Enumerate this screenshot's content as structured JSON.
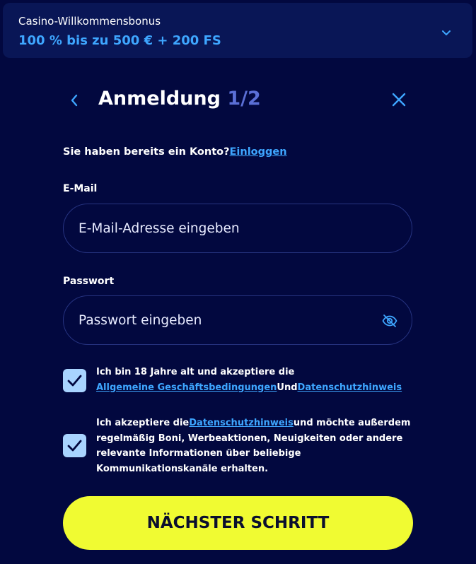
{
  "bonus": {
    "title": "Casino-Willkommensbonus",
    "value": "100 % bis zu 500 € + 200 FS",
    "toggle_icon": "chevron-down-icon"
  },
  "header": {
    "back_icon": "chevron-left-icon",
    "title": "Anmeldung",
    "step": "1/2",
    "close_icon": "close-icon"
  },
  "login_prompt": {
    "text": "Sie haben bereits ein Konto?",
    "link": "Einloggen"
  },
  "email": {
    "label": "E-Mail",
    "placeholder": "E-Mail-Adresse eingeben",
    "value": ""
  },
  "password": {
    "label": "Passwort",
    "placeholder": "Passwort eingeben",
    "value": "",
    "toggle_icon": "eye-off-icon"
  },
  "consent_terms": {
    "checked": true,
    "text": "Ich bin 18 Jahre alt und akzeptiere die",
    "link_terms": "Allgemeine Geschäftsbedingungen",
    "conjunction": "Und",
    "link_privacy": "Datenschutzhinweis"
  },
  "consent_marketing": {
    "checked": true,
    "text_before": "Ich akzeptiere die",
    "link_privacy": "Datenschutzhinweis",
    "text_after": "und möchte außerdem regelmäßig Boni, Werbeaktionen, Neuigkeiten oder andere relevante Informationen über beliebige Kommunikationskanäle erhalten."
  },
  "next_button": {
    "label": "NÄCHSTER SCHRITT"
  },
  "colors": {
    "background": "#02083f",
    "banner": "#091656",
    "accent": "#3ea6ff",
    "step": "#5b6fd6",
    "checkbox": "#a8d4ff",
    "cta": "#f0fb32"
  }
}
